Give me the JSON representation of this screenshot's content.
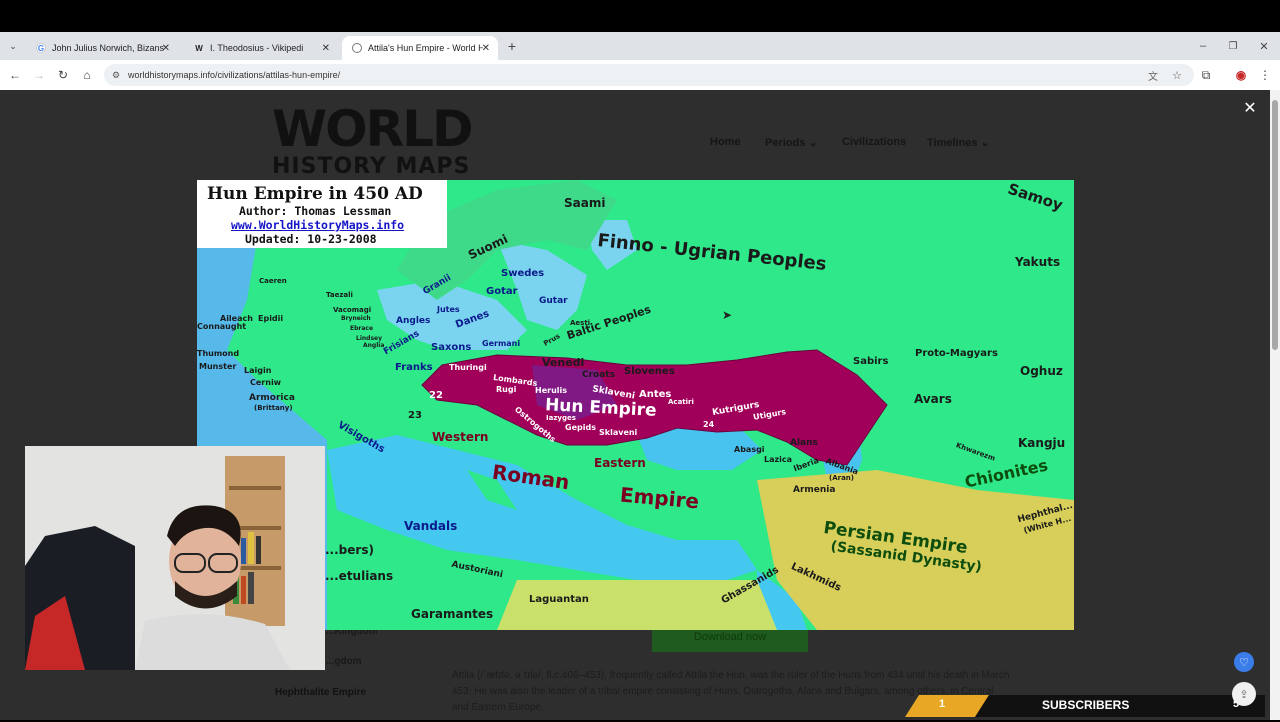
{
  "browser": {
    "tabs": [
      {
        "title": "John Julius Norwich, Bizans I Er...",
        "favicon": "google-icon"
      },
      {
        "title": "I. Theodosius - Vikipedi",
        "favicon": "wikipedia-icon"
      },
      {
        "title": "Attila's Hun Empire - World His...",
        "favicon": "globe-icon"
      }
    ],
    "url": "worldhistorymaps.info/civilizations/attilas-hun-empire/"
  },
  "site": {
    "logo_line1": "WORLD",
    "logo_line2": "HISTORY MAPS",
    "nav": {
      "home": "Home",
      "periods": "Periods",
      "civilizations": "Civilizations",
      "timelines": "Timelines"
    },
    "sidebar_items": [
      "...Kingdom",
      "...gdom",
      "Hephthalite Empire"
    ],
    "download_label": "Download now",
    "paragraph": "Attila (/ˈætɪlə, əˈtɪlə/; fl.c.406–453), frequently called Attila the Hun, was the ruler of the Huns from 434 until his death in March 453. He was also the leader of a tribal empire consisting of Huns, Ostrogoths, Alans and Bulgars, among others, in Central and Eastern Europe."
  },
  "map": {
    "title": "Hun Empire in 450 AD",
    "author": "Author: Thomas Lessman",
    "website": "www.WorldHistoryMaps.info",
    "updated": "Updated:  10-23-2008",
    "labels": {
      "saami": "Saami",
      "samoy": "Samoy",
      "finno": "Finno - Ugrian  Peoples",
      "yakuts": "Yakuts",
      "suomi": "Suomi",
      "swedes": "Swedes",
      "gotar": "Gotar",
      "gutar": "Gutar",
      "granii": "Granii",
      "jutes": "Jutes",
      "danes": "Danes",
      "angles": "Angles",
      "frisians": "Frisians",
      "saxons": "Saxons",
      "germani": "Germani",
      "aesti": "Aesti",
      "baltic": "Baltic  Peoples",
      "prus": "Prus",
      "venedi": "Venedi",
      "slovenes": "Slovenes",
      "croats": "Croats",
      "antes": "Antes",
      "sabirs": "Sabirs",
      "proto_magyars": "Proto-Magyars",
      "oghuz": "Oghuz",
      "avars": "Avars",
      "kangju": "Kangju",
      "khwarezm": "Khwarezm",
      "chionites": "Chionites",
      "thuringi": "Thuringi",
      "lombards": "Lombards",
      "rugi": "Rugi",
      "herulis": "Herulis",
      "sklaveni": "Sklaveni",
      "hun_empire": "Hun  Empire",
      "acatiri": "Acatiri",
      "kutrigurs": "Kutrigurs",
      "utigurs": "Utigurs",
      "iazyges": "Iazyges",
      "ostrogoths": "Ostrogoths",
      "gepids": "Gepids",
      "sklaveni2": "Sklaveni",
      "num22": "22",
      "num23": "23",
      "num24": "24",
      "caeren": "Caeren",
      "taezali": "Taezali",
      "vacomagi": "Vacomagi",
      "bryneich": "Bryneich",
      "ebrace": "Ebrace",
      "lindsey": "Lindsey",
      "anglia": "Anglia",
      "aileach": "Aileach",
      "connaught": "Connaught",
      "epidii": "Epidii",
      "thumond": "Thumond",
      "munster": "Munster",
      "laigin": "Laigin",
      "cerniw": "Cerniw",
      "armorica": "Armorica",
      "brittany": "(Brittany)",
      "franks": "Franks",
      "visigoths": "Visigoths",
      "western": "Western",
      "roman": "Roman",
      "empire": "Empire",
      "eastern": "Eastern",
      "vandals": "Vandals",
      "berbers": "...bers)",
      "getulians": "...etulians",
      "garamantes": "Garamantes",
      "austoriani": "Austoriani",
      "laguantan": "Laguantan",
      "ghassanids": "Ghassanids",
      "lakhmids": "Lakhmids",
      "persian": "Persian  Empire",
      "sassanid": "(Sassanid  Dynasty)",
      "alans": "Alans",
      "abasgi": "Abasgi",
      "lazica": "Lazica",
      "iberia": "Iberia",
      "albania": "Albania",
      "aran": "(Aran)",
      "armenia": "Armenia",
      "hephthalites": "Hephthal...",
      "white_hun": "(White H..."
    }
  },
  "subscribers": {
    "count_left": "1",
    "label": "SUBSCRIBERS",
    "count_right": "5"
  },
  "colors": {
    "hun_empire": "#a1005a",
    "land_green": "#2ee88a",
    "sea_blue": "#7ad4f0",
    "desert": "#d8cf5a"
  }
}
